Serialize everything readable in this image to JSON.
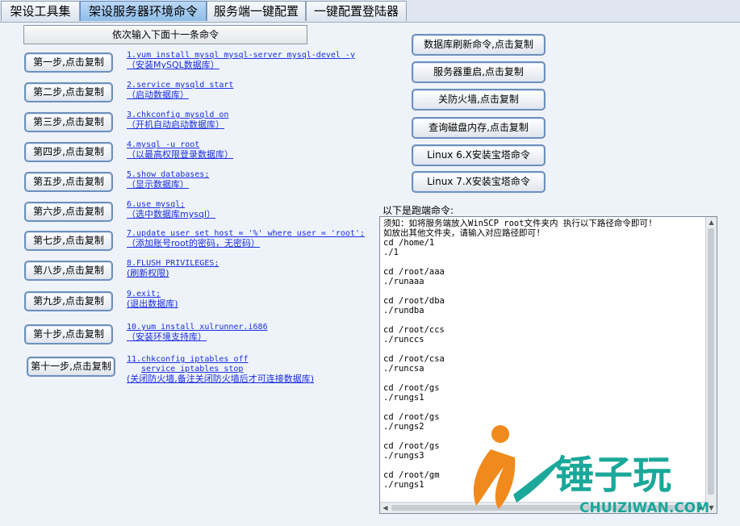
{
  "tabs": [
    {
      "label": "架设工具集"
    },
    {
      "label": "架设服务器环境命令"
    },
    {
      "label": "服务端一键配置"
    },
    {
      "label": "一键配置登陆器"
    }
  ],
  "header_button": "依次输入下面十一条命令",
  "steps": [
    {
      "button": "第一步,点击复制",
      "cmd": "1.yum install mysql mysql-server mysql-devel -y",
      "desc": "（安装MySQL数据库）"
    },
    {
      "button": "第二步,点击复制",
      "cmd": "2.service mysqld start",
      "desc": "（启动数据库）"
    },
    {
      "button": "第三步,点击复制",
      "cmd": "3.chkconfig mysqld on",
      "desc": "（开机自动启动数据库）"
    },
    {
      "button": "第四步,点击复制",
      "cmd": "4.mysql -u root",
      "desc": "（以最高权限登录数据库）"
    },
    {
      "button": "第五步,点击复制",
      "cmd": "5.show databases;",
      "desc": "（显示数据库）"
    },
    {
      "button": "第六步,点击复制",
      "cmd": "6.use mysql;",
      "desc": "（选中数据库mysql）"
    },
    {
      "button": "第七步,点击复制",
      "cmd": "7.update user set host = '%' where user = 'root';",
      "desc": "（添加账号root的密码，无密码）"
    },
    {
      "button": "第八步,点击复制",
      "cmd": "8.FLUSH PRIVILEGES;",
      "desc": "(刷新权限)"
    },
    {
      "button": "第九步,点击复制",
      "cmd": "9.exit;",
      "desc": "(退出数据库)"
    },
    {
      "button": "第十步,点击复制",
      "cmd": "10.yum install xulrunner.i686",
      "desc": "（安装环境支持库）"
    },
    {
      "button": "第十一步,点击复制",
      "cmd": "11.chkconfig iptables off",
      "cmd2": "service iptables stop",
      "desc": "(关闭防火墙,备注关闭防火墙后才可连接数据库)"
    }
  ],
  "right_buttons": [
    {
      "label": "数据库刷新命令,点击复制"
    },
    {
      "label": "服务器重启,点击复制"
    },
    {
      "label": "关防火墙,点击复制"
    },
    {
      "label": "查询磁盘内存,点击复制"
    },
    {
      "label": "Linux 6.X安装宝塔命令"
    },
    {
      "label": "Linux 7.X安装宝塔命令"
    }
  ],
  "output_label": "以下是跑端命令:",
  "output_text": "须知：如将服务端放入WinSCP root文件夹内 执行以下路径命令即可!\n如放出其他文件夹，请输入对应路径即可!\ncd /home/1\n./1\n\ncd /root/aaa\n./runaaa\n\ncd /root/dba\n./rundba\n\ncd /root/ccs\n./runccs\n\ncd /root/csa\n./runcsa\n\ncd /root/gs\n./rungs1\n\ncd /root/gs\n./rungs2\n\ncd /root/gs\n./rungs3\n\ncd /root/gm\n./rungs1",
  "watermark": {
    "brand": "锤子玩",
    "url": "CHUIZIWAN.COM",
    "orange": "#f08a1c",
    "teal": "#1aa89a"
  }
}
